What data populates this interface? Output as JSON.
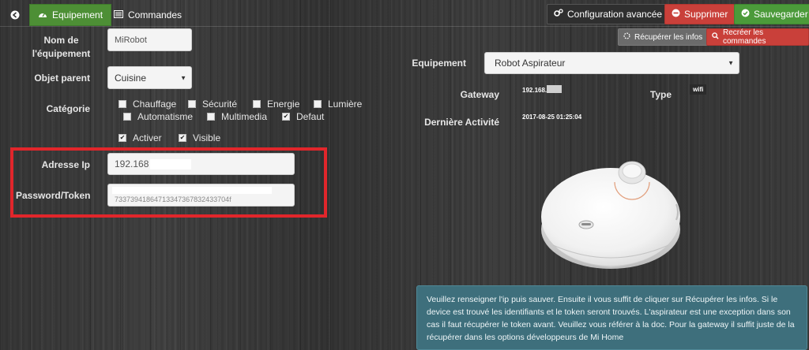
{
  "tabs": {
    "equipement": "Equipement",
    "commandes": "Commandes"
  },
  "toolbar": {
    "config": "Configuration avancée",
    "delete": "Supprimer",
    "save": "Sauvegarder",
    "recup": "Récupérer les infos",
    "recreer": "Recréer les commandes"
  },
  "form": {
    "nom_label_1": "Nom de",
    "nom_label_2": "l'équipement",
    "nom_value": "MiRobot",
    "objet_label": "Objet parent",
    "objet_value": "Cuisine",
    "categorie_label": "Catégorie",
    "categories": [
      {
        "label": "Chauffage",
        "checked": false
      },
      {
        "label": "Sécurité",
        "checked": false
      },
      {
        "label": "Energie",
        "checked": false
      },
      {
        "label": "Lumière",
        "checked": false
      },
      {
        "label": "Automatisme",
        "checked": false
      },
      {
        "label": "Multimedia",
        "checked": false
      },
      {
        "label": "Defaut",
        "checked": true
      }
    ],
    "activer": "Activer",
    "visible": "Visible",
    "ip_label": "Adresse Ip",
    "ip_value": "192.168",
    "token_label": "Password/Token",
    "token_value": "73373941864713347367832433704f"
  },
  "right": {
    "equipement_label": "Equipement",
    "equipement_value": "Robot Aspirateur",
    "gateway_label": "Gateway",
    "gateway_value": "192.168.",
    "type_label": "Type",
    "type_value": "wifi",
    "activity_label": "Dernière Activité",
    "activity_value": "2017-08-25 01:25:04"
  },
  "info": "Veuillez renseigner l'ip puis sauver. Ensuite il vous suffit de cliquer sur Récupérer les infos. Si le device est trouvé les identifiants et le token seront trouvés. L'aspirateur est une exception dans son cas il faut récupérer le token avant. Veuillez vous référer à la doc. Pour la gateway il suffit juste de la récupérer dans les options développeurs de Mi Home",
  "colors": {
    "tab_active": "#4d8f35",
    "delete": "#c9403a",
    "save": "#4b9a3a",
    "highlight": "#e1262b",
    "info_bg": "#3e6f7c"
  }
}
